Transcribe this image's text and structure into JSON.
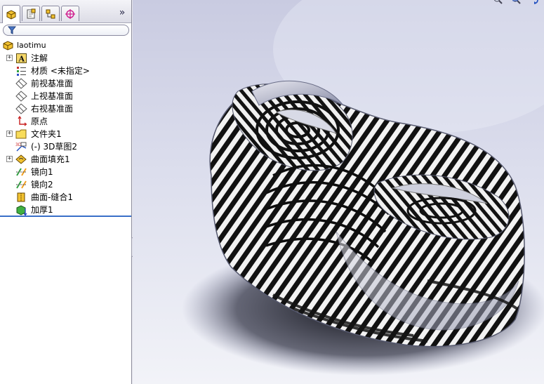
{
  "feature_manager": {
    "tabs": [
      {
        "name": "featuremanager-tab",
        "icon": "feature-tree-icon"
      },
      {
        "name": "propertymanager-tab",
        "icon": "property-manager-icon"
      },
      {
        "name": "configurationmanager-tab",
        "icon": "configuration-icon"
      },
      {
        "name": "dimxpert-tab",
        "icon": "crosshair-target-icon"
      }
    ],
    "expand_label": "»",
    "filter": {
      "value": "",
      "placeholder": ""
    },
    "root": {
      "label": "laotimu",
      "icon": "part-icon"
    },
    "items": [
      {
        "label": "注解",
        "icon": "annotation-icon",
        "expandable": true
      },
      {
        "label": "材质 <未指定>",
        "icon": "material-icon",
        "expandable": false
      },
      {
        "label": "前视基准面",
        "icon": "plane-icon",
        "expandable": false
      },
      {
        "label": "上视基准面",
        "icon": "plane-icon",
        "expandable": false
      },
      {
        "label": "右视基准面",
        "icon": "plane-icon",
        "expandable": false
      },
      {
        "label": "原点",
        "icon": "origin-icon",
        "expandable": false
      },
      {
        "label": "文件夹1",
        "icon": "folder-icon",
        "expandable": true
      },
      {
        "label": "(-) 3D草图2",
        "icon": "sketch-3d-icon",
        "expandable": false
      },
      {
        "label": "曲面填充1",
        "icon": "surface-fill-icon",
        "expandable": true
      },
      {
        "label": "镜向1",
        "icon": "mirror-icon",
        "expandable": false
      },
      {
        "label": "镜向2",
        "icon": "mirror-icon",
        "expandable": false
      },
      {
        "label": "曲面-缝合1",
        "icon": "surface-knit-icon",
        "expandable": false
      },
      {
        "label": "加厚1",
        "icon": "thicken-icon",
        "expandable": false
      }
    ],
    "splitter_glyph": "‹‹"
  },
  "viewport": {
    "tools": [
      "zoom-to-fit-icon",
      "zoom-area-icon",
      "rotate-view-icon"
    ],
    "colors": {
      "stripe_dark": "#111111",
      "stripe_light": "#f2f2f2",
      "background_top": "#c9cbe1"
    }
  }
}
